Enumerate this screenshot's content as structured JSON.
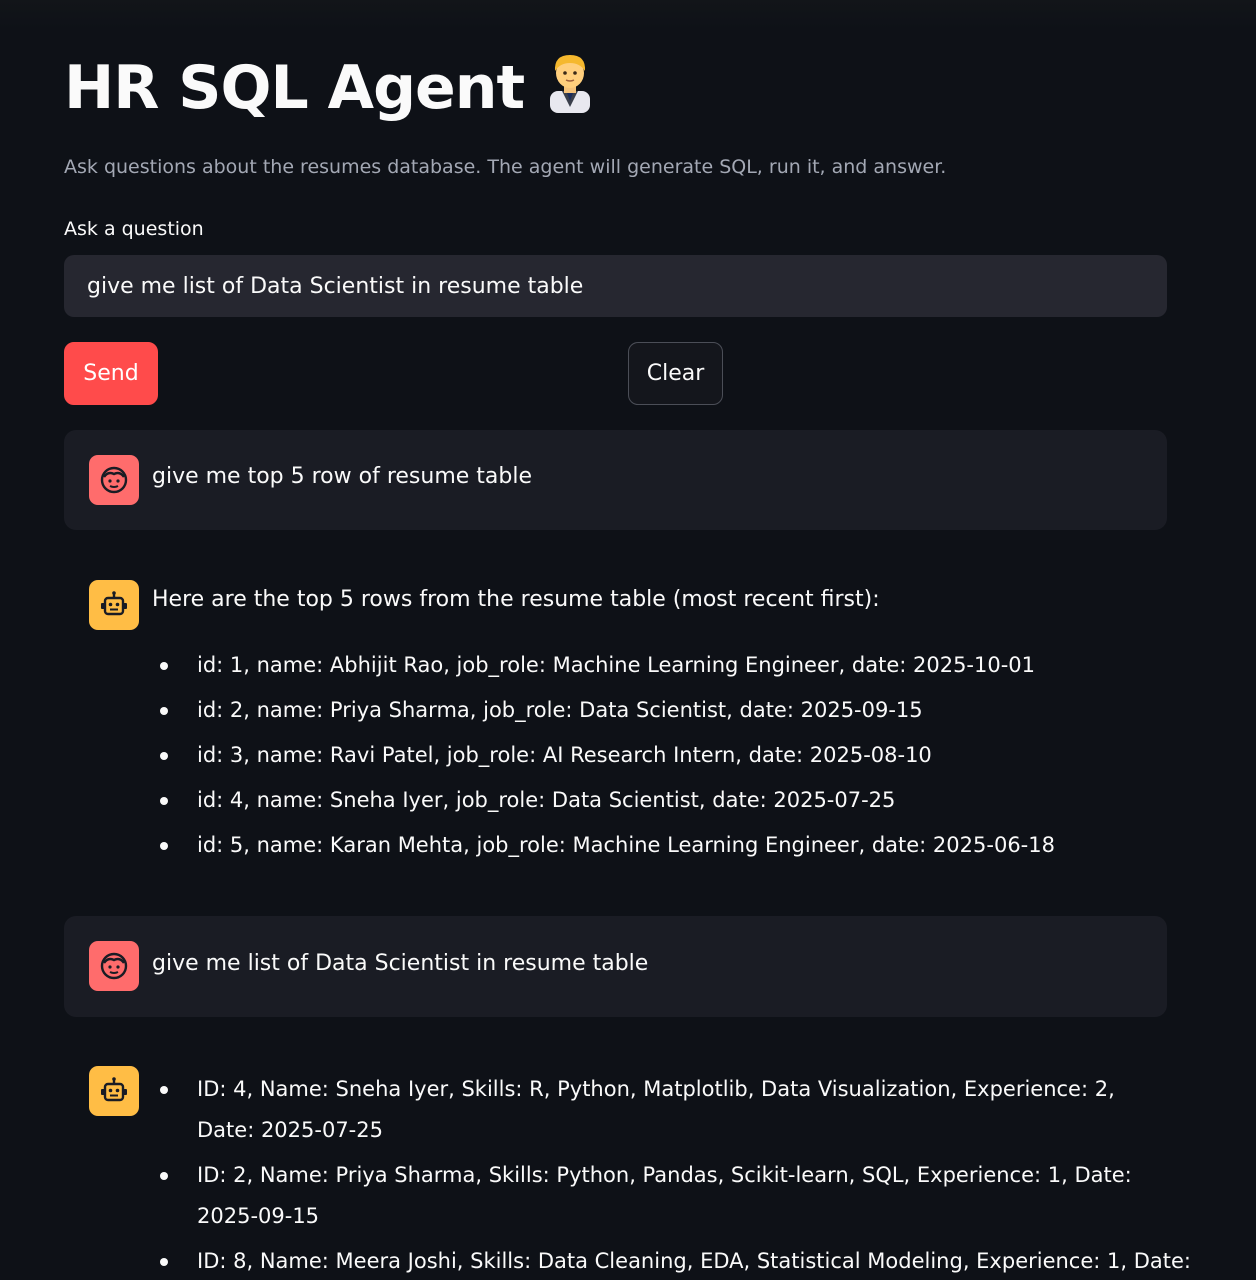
{
  "app": {
    "title": "HR SQL Agent",
    "title_emoji": "person-in-suit-icon",
    "subtitle": "Ask questions about the resumes database. The agent will generate SQL, run it, and answer."
  },
  "question_input": {
    "label": "Ask a question",
    "value": "give me list of Data Scientist in resume table"
  },
  "buttons": {
    "send_label": "Send",
    "clear_label": "Clear"
  },
  "colors": {
    "background": "#0e1117",
    "primary": "#ff4b4b",
    "user_avatar": "#ff6c6c",
    "bot_avatar": "#ffbd45",
    "user_bubble": "#1a1c24"
  },
  "chat": [
    {
      "role": "user",
      "avatar_icon": "user-face-icon",
      "text": "give me top 5 row of resume table"
    },
    {
      "role": "assistant",
      "avatar_icon": "robot-icon",
      "intro": "Here are the top 5 rows from the resume table (most recent first):",
      "items": [
        "id: 1, name: Abhijit Rao, job_role: Machine Learning Engineer, date: 2025-10-01",
        "id: 2, name: Priya Sharma, job_role: Data Scientist, date: 2025-09-15",
        "id: 3, name: Ravi Patel, job_role: AI Research Intern, date: 2025-08-10",
        "id: 4, name: Sneha Iyer, job_role: Data Scientist, date: 2025-07-25",
        "id: 5, name: Karan Mehta, job_role: Machine Learning Engineer, date: 2025-06-18"
      ]
    },
    {
      "role": "user",
      "avatar_icon": "user-face-icon",
      "text": "give me list of Data Scientist in resume table"
    },
    {
      "role": "assistant",
      "avatar_icon": "robot-icon",
      "items": [
        "ID: 4, Name: Sneha Iyer, Skills: R, Python, Matplotlib, Data Visualization, Experience: 2, Date: 2025-07-25",
        "ID: 2, Name: Priya Sharma, Skills: Python, Pandas, Scikit-learn, SQL, Experience: 1, Date: 2025-09-15",
        "ID: 8, Name: Meera Joshi, Skills: Data Cleaning, EDA, Statistical Modeling, Experience: 1, Date:"
      ]
    }
  ]
}
